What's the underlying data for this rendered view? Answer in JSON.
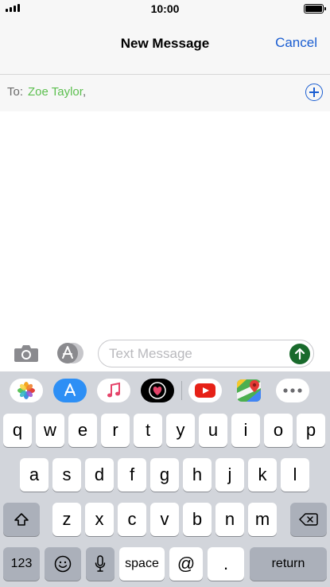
{
  "status_bar": {
    "time": "10:00"
  },
  "nav": {
    "title": "New Message",
    "cancel_label": "Cancel"
  },
  "recipient": {
    "to_label": "To:",
    "name": "Zoe Taylor",
    "separator": ","
  },
  "compose": {
    "placeholder": "Text Message",
    "value": ""
  },
  "app_strip": [
    "photos-app",
    "app-store-app",
    "music-app",
    "digital-touch-app",
    "youtube-app",
    "google-maps-app",
    "more-apps"
  ],
  "keyboard": {
    "row1": [
      "q",
      "w",
      "e",
      "r",
      "t",
      "y",
      "u",
      "i",
      "o",
      "p"
    ],
    "row2": [
      "a",
      "s",
      "d",
      "f",
      "g",
      "h",
      "j",
      "k",
      "l"
    ],
    "row3": [
      "z",
      "x",
      "c",
      "v",
      "b",
      "n",
      "m"
    ],
    "numbers_label": "123",
    "space_label": "space",
    "at_label": "@",
    "period_label": ".",
    "return_label": "return"
  },
  "colors": {
    "accent": "#1a5dd1",
    "recipient": "#5cbf4f",
    "send": "#196a2c",
    "keyboard_bg": "#d2d5db"
  }
}
